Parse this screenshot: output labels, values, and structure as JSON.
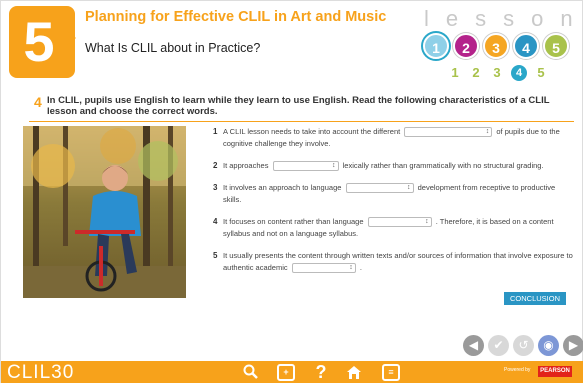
{
  "header": {
    "lesson_number": "5",
    "course_title": "Planning for Effective CLIL in Art and Music",
    "section_title": "What Is CLIL about in Practice?",
    "lesson_word": "lesson",
    "lesson_circles": [
      {
        "label": "1",
        "color": "#8fd0e8"
      },
      {
        "label": "2",
        "color": "#b4238b"
      },
      {
        "label": "3",
        "color": "#f5a623"
      },
      {
        "label": "4",
        "color": "#2a95c4"
      },
      {
        "label": "5",
        "color": "#a9c24b"
      }
    ],
    "active_lesson_circle": "1",
    "lesson_numbers": [
      "1",
      "2",
      "3",
      "4",
      "5"
    ],
    "active_lesson_number": "4"
  },
  "instruction": {
    "number": "4",
    "text": "In CLIL, pupils use English to learn while they learn to use English. Read the following characteristics of a CLIL lesson and choose the correct words."
  },
  "questions": [
    {
      "n": "1",
      "before": "A CLIL lesson needs to take into account the different",
      "after": "of pupils due to the cognitive challenge they involve."
    },
    {
      "n": "2",
      "before": "It approaches",
      "after": "lexically rather than grammatically with no structural grading."
    },
    {
      "n": "3",
      "before": "It involves an approach to language",
      "after": "development from receptive to productive skills."
    },
    {
      "n": "4",
      "before": "It focuses on content rather than language",
      "after": ". Therefore, it is based on a content syllabus and not on a language syllabus."
    },
    {
      "n": "5",
      "before": "It usually presents the content through written texts and/or sources of information that involve exposure to authentic academic",
      "after": "."
    }
  ],
  "buttons": {
    "conclusion": "CONCLUSION"
  },
  "nav": {
    "back": "◀",
    "check": "✔",
    "clear": "↺",
    "audio": "◉",
    "next": "▶"
  },
  "footer": {
    "brand": "CLIL30",
    "search_icon": "search-icon",
    "tools_icon": "tools-icon",
    "help_icon": "help-icon",
    "home_icon": "home-icon",
    "menu_icon": "menu-icon",
    "publisher_text": "Powered by",
    "publisher_logo": "PEARSON"
  },
  "colors": {
    "accent": "#f7a21b",
    "button_blue": "#2a95c4"
  }
}
